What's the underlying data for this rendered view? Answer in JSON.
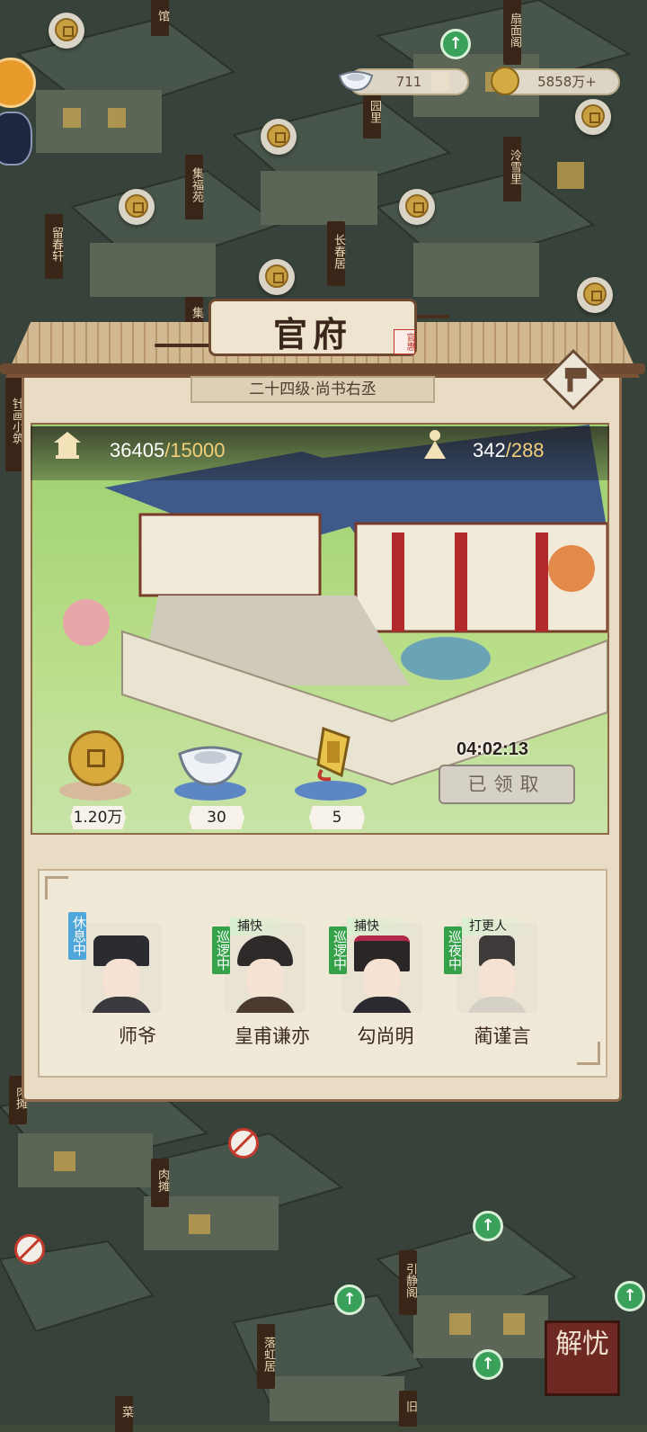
{
  "top_bar": {
    "silver_amount": "711",
    "coin_amount": "5858万+"
  },
  "map_labels": {
    "liuchun": "留春轩",
    "jifu": "集福苑",
    "changchun": "长春居",
    "lengxue": "泠雪里",
    "yuan_li": "园里",
    "shanmian": "扇面阁",
    "guan": "馆",
    "ji": "集",
    "left_edge": "针画小筑",
    "rou1": "肉摊",
    "rou2": "肉摊",
    "yinjing": "引静阁",
    "luohong": "落虹居",
    "bottom_cut": "菜",
    "right_cut": "旧"
  },
  "panel": {
    "title": "官府",
    "seal": "官惠",
    "rank": "二十四级·尚书右丞",
    "stat1_value": "36405",
    "stat1_max": "/15000",
    "stat2_value": "342",
    "stat2_max": "/288",
    "rewards": [
      {
        "icon": "copper-coin-icon",
        "value": "1.20万"
      },
      {
        "icon": "silver-ingot-icon",
        "value": "30"
      },
      {
        "icon": "token-icon",
        "value": "5"
      }
    ],
    "timer": "04:02:13",
    "claim_label": "已领取"
  },
  "officers": [
    {
      "name": "师爷",
      "role": "",
      "status": "休息中"
    },
    {
      "name": "皇甫谦亦",
      "role": "捕快",
      "status": "巡逻中"
    },
    {
      "name": "勾尚明",
      "role": "捕快",
      "status": "巡逻中"
    },
    {
      "name": "蔺谨言",
      "role": "打更人",
      "status": "巡夜中"
    }
  ],
  "jieyou": "解忧",
  "colors": {
    "accent_wood": "#8c6a4a",
    "status_green": "#35a24a",
    "status_blue": "#4ea6d9"
  }
}
